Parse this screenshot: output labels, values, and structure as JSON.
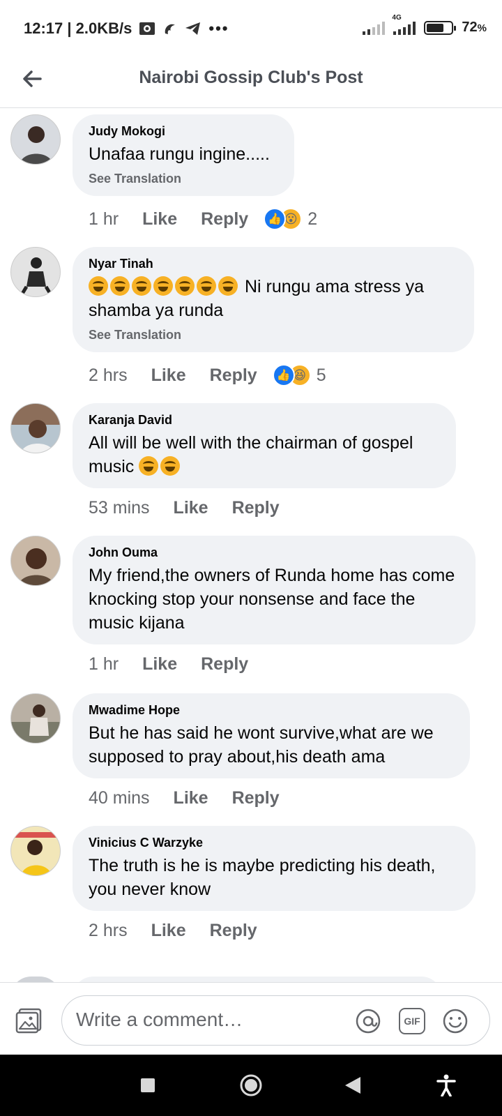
{
  "status_bar": {
    "time": "12:17",
    "speed": "2.0KB/s",
    "network": "4G",
    "battery_level": 0.72,
    "battery_text": "72",
    "percent_sign": "%"
  },
  "header": {
    "title": "Nairobi Gossip Club's Post"
  },
  "comments": [
    {
      "name": "Judy Mokogi",
      "text": "Unafaa rungu ingine.....",
      "translation": "See Translation",
      "time": "1 hr",
      "like": "Like",
      "reply": "Reply",
      "reaction_count": "2",
      "reactions": [
        "like-icon",
        "wow-icon"
      ],
      "avatar_color": "#d8dbe0"
    },
    {
      "name": "Nyar Tinah",
      "text": "Ni rungu ama stress ya shamba ya runda",
      "emoji_count": 7,
      "translation": "See Translation",
      "time": "2 hrs",
      "like": "Like",
      "reply": "Reply",
      "reaction_count": "5",
      "reactions": [
        "like-icon",
        "laugh-icon"
      ],
      "avatar_color": "#e3e3e3"
    },
    {
      "name": "Karanja David",
      "text": "All will be well with the chairman of gospel music",
      "emoji_count": 2,
      "time": "53 mins",
      "like": "Like",
      "reply": "Reply",
      "avatar_color": "#b7c5cf"
    },
    {
      "name": "John Ouma",
      "text": "My friend,the owners of Runda home has come knocking stop your nonsense and face the music kijana",
      "time": "1 hr",
      "like": "Like",
      "reply": "Reply",
      "avatar_color": "#c9b8a6"
    },
    {
      "name": "Mwadime Hope",
      "text": "But he has said he wont survive,what are we supposed to pray about,his death ama",
      "time": "40 mins",
      "like": "Like",
      "reply": "Reply",
      "avatar_color": "#b9b0a4"
    },
    {
      "name": "Vinicius C Warzyke",
      "text": "The truth is he is maybe predicting his death, you never know",
      "time": "2 hrs",
      "like": "Like",
      "reply": "Reply",
      "avatar_color": "#f2e6b8"
    }
  ],
  "composer": {
    "placeholder": "Write a comment…",
    "gif_label": "GIF"
  },
  "colors": {
    "accent": "#1877f2",
    "bubble": "#f0f2f5",
    "muted": "#65676b"
  }
}
